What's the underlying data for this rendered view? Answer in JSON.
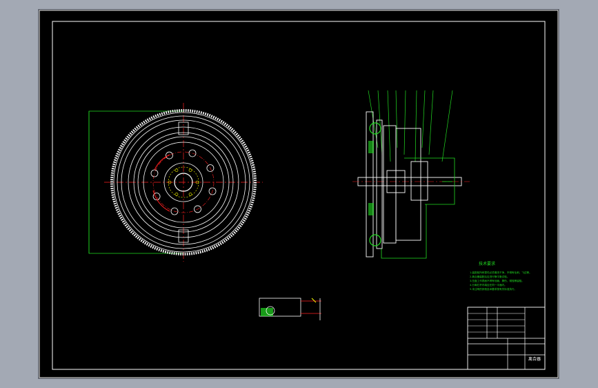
{
  "drawing": {
    "tech_requirements_title": "技术要求",
    "tech_requirements": [
      "1.装配前所有零件必须清洗干净，不得有毛刺、飞边等。",
      "2.离合器装配后应进行静平衡试验。",
      "3.压盘工作表面不得有划痕、擦伤、锈蚀等缺陷。",
      "4.分离杠杆内端应在同一平面内。",
      "5.未注明的其他技术要求按有关标准执行。"
    ],
    "title_block": {
      "drawing_name": "离合器",
      "cells": [
        "",
        "",
        "",
        "",
        "",
        "",
        "",
        ""
      ]
    }
  },
  "colors": {
    "background": "#000000",
    "frame": "#ffffff",
    "geometry": "#ffffff",
    "leaders": "#22dd22",
    "center_lines": "#ff2020",
    "accent": "#ffff00"
  }
}
